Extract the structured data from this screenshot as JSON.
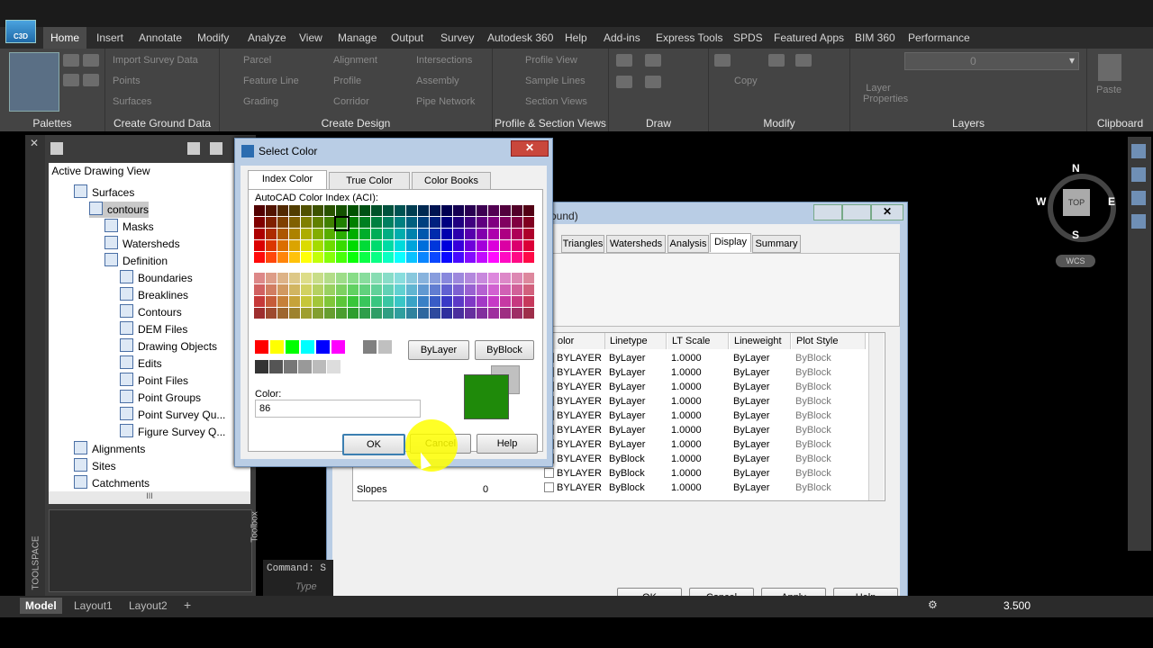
{
  "app": {
    "logo": "C3D"
  },
  "ribbon": {
    "tabs": [
      "Home",
      "Insert",
      "Annotate",
      "Modify",
      "Analyze",
      "View",
      "Manage",
      "Output",
      "Survey",
      "Autodesk 360",
      "Help",
      "Add-ins",
      "Express Tools",
      "SPDS",
      "Featured Apps",
      "BIM 360",
      "Performance"
    ],
    "active_tab": "Home",
    "panels": {
      "palettes": "Palettes",
      "ground": "Create Ground Data",
      "design": "Create Design",
      "profile": "Profile & Section Views",
      "draw": "Draw",
      "modify": "Modify",
      "layers": "Layers",
      "clipboard": "Clipboard"
    },
    "buttons": {
      "import_survey": "Import Survey Data",
      "points": "Points",
      "surfaces": "Surfaces",
      "parcel": "Parcel",
      "feature_line": "Feature Line",
      "grading": "Grading",
      "alignment": "Alignment",
      "profile": "Profile",
      "corridor": "Corridor",
      "intersections": "Intersections",
      "assembly": "Assembly",
      "pipe_network": "Pipe Network",
      "profile_view": "Profile View",
      "sample_lines": "Sample Lines",
      "section_views": "Section Views",
      "copy": "Copy",
      "layer_properties": "Layer Properties",
      "paste": "Paste",
      "layer_value": "0"
    }
  },
  "toolspace": {
    "label": "TOOLSPACE",
    "toolbox_label": "Toolbox",
    "view": "Active Drawing View",
    "tree": [
      {
        "label": "Surfaces",
        "level": 0
      },
      {
        "label": "contours",
        "level": 1,
        "selected": true
      },
      {
        "label": "Masks",
        "level": 2
      },
      {
        "label": "Watersheds",
        "level": 2
      },
      {
        "label": "Definition",
        "level": 2
      },
      {
        "label": "Boundaries",
        "level": 3
      },
      {
        "label": "Breaklines",
        "level": 3
      },
      {
        "label": "Contours",
        "level": 3
      },
      {
        "label": "DEM Files",
        "level": 3
      },
      {
        "label": "Drawing Objects",
        "level": 3
      },
      {
        "label": "Edits",
        "level": 3
      },
      {
        "label": "Point Files",
        "level": 3
      },
      {
        "label": "Point Groups",
        "level": 3
      },
      {
        "label": "Point Survey Qu...",
        "level": 3
      },
      {
        "label": "Figure Survey Q...",
        "level": 3
      },
      {
        "label": "Alignments",
        "level": 0
      },
      {
        "label": "Sites",
        "level": 0
      },
      {
        "label": "Catchments",
        "level": 0
      }
    ],
    "scroll_mid": "III"
  },
  "select_color": {
    "title": "Select Color",
    "tabs": [
      "Index Color",
      "True Color",
      "Color Books"
    ],
    "aci_label": "AutoCAD Color Index (ACI):",
    "bylayer": "ByLayer",
    "byblock": "ByBlock",
    "color_label": "Color:",
    "color_value": "86",
    "preview_color": "#1f8a0a",
    "ok": "OK",
    "cancel": "Cancel",
    "help": "Help"
  },
  "surface_props": {
    "title_fragment": "ound)",
    "tabs": [
      "Triangles",
      "Watersheds",
      "Analysis",
      "Display",
      "Summary"
    ],
    "active_tab": "Display",
    "columns": [
      "olor",
      "Linetype",
      "LT Scale",
      "Lineweight",
      "Plot Style"
    ],
    "rows": [
      [
        "BYLAYER",
        "ByLayer",
        "1.0000",
        "ByLayer",
        "ByBlock"
      ],
      [
        "BYLAYER",
        "ByLayer",
        "1.0000",
        "ByLayer",
        "ByBlock"
      ],
      [
        "BYLAYER",
        "ByLayer",
        "1.0000",
        "ByLayer",
        "ByBlock"
      ],
      [
        "BYLAYER",
        "ByLayer",
        "1.0000",
        "ByLayer",
        "ByBlock"
      ],
      [
        "BYLAYER",
        "ByLayer",
        "1.0000",
        "ByLayer",
        "ByBlock"
      ],
      [
        "BYLAYER",
        "ByLayer",
        "1.0000",
        "ByLayer",
        "ByBlock"
      ],
      [
        "BYLAYER",
        "ByLayer",
        "1.0000",
        "ByLayer",
        "ByBlock"
      ],
      [
        "BYLAYER",
        "ByBlock",
        "1.0000",
        "ByLayer",
        "ByBlock"
      ],
      [
        "BYLAYER",
        "ByBlock",
        "1.0000",
        "ByLayer",
        "ByBlock"
      ],
      [
        "BYLAYER",
        "ByBlock",
        "1.0000",
        "ByLayer",
        "ByBlock"
      ]
    ],
    "last_row_name": "Slopes",
    "last_row_num": "0",
    "ok": "OK",
    "cancel": "Cancel",
    "apply": "Apply",
    "help": "Help"
  },
  "viewcube": {
    "n": "N",
    "s": "S",
    "e": "E",
    "w": "W",
    "top": "TOP",
    "wcs": "WCS"
  },
  "command": {
    "prompt": "Command: S",
    "placeholder": "Type"
  },
  "status": {
    "tabs": [
      "Model",
      "Layout1",
      "Layout2"
    ],
    "add": "+",
    "scale": "3.500"
  }
}
